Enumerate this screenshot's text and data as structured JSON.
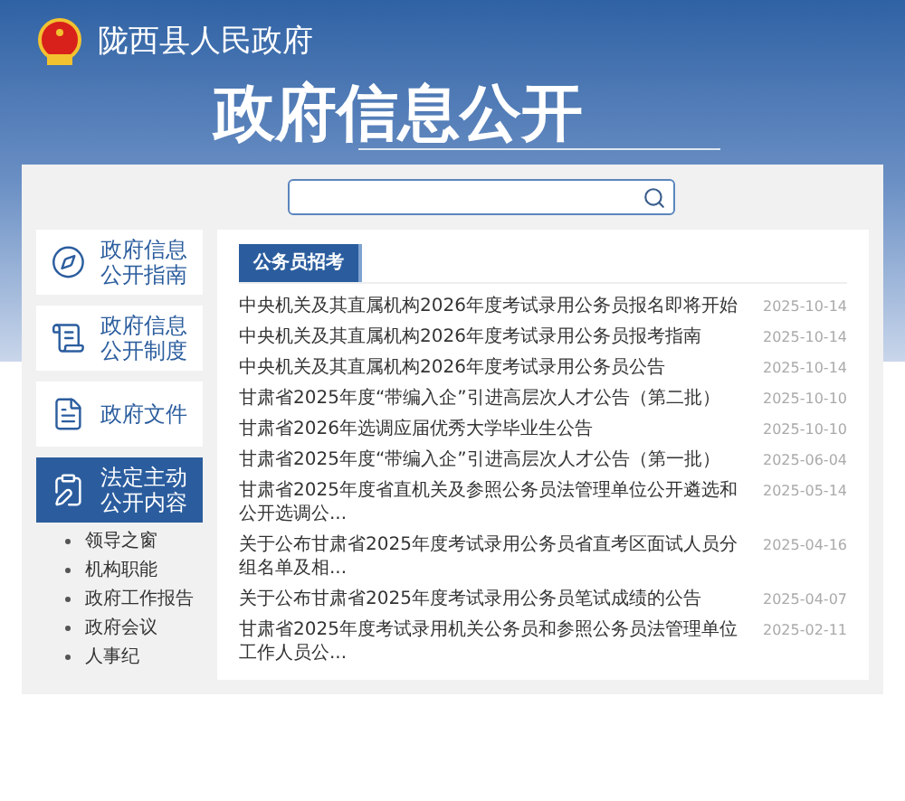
{
  "site_title": "陇西县人民政府",
  "banner_title": "政府信息公开",
  "sidebar": {
    "items": [
      {
        "label": "政府信息公开指南",
        "selected": false
      },
      {
        "label": "政府信息公开制度",
        "selected": false
      },
      {
        "label": "政府文件",
        "selected": false
      },
      {
        "label": "法定主动公开内容",
        "selected": true,
        "children": [
          {
            "label": "领导之窗"
          },
          {
            "label": "机构职能"
          },
          {
            "label": "政府工作报告"
          },
          {
            "label": "政府会议"
          },
          {
            "label": "人事纪"
          }
        ]
      }
    ]
  },
  "tabs": [
    {
      "label": "公务员招考",
      "selected": true
    }
  ],
  "rows": [
    {
      "title": "中央机关及其直属机构2026年度考试录用公务员报名即将开始",
      "date": "2025-10-14"
    },
    {
      "title": "中央机关及其直属机构2026年度考试录用公务员报考指南",
      "date": "2025-10-14"
    },
    {
      "title": "中央机关及其直属机构2026年度考试录用公务员公告",
      "date": "2025-10-14"
    },
    {
      "title": "甘肃省2025年度“带编入企”引进高层次人才公告（第二批）",
      "date": "2025-10-10"
    },
    {
      "title": "甘肃省2026年选调应届优秀大学毕业生公告",
      "date": "2025-10-10"
    },
    {
      "title": "甘肃省2025年度“带编入企”引进高层次人才公告（第一批）",
      "date": "2025-06-04"
    },
    {
      "title": "甘肃省2025年度省直机关及参照公务员法管理单位公开遴选和公开选调公...",
      "date": "2025-05-14"
    },
    {
      "title": "关于公布甘肃省2025年度考试录用公务员省直考区面试人员分组名单及相...",
      "date": "2025-04-16"
    },
    {
      "title": "关于公布甘肃省2025年度考试录用公务员笔试成绩的公告",
      "date": "2025-04-07"
    },
    {
      "title": "甘肃省2025年度考试录用机关公务员和参照公务员法管理单位工作人员公...",
      "date": "2025-02-11"
    }
  ]
}
